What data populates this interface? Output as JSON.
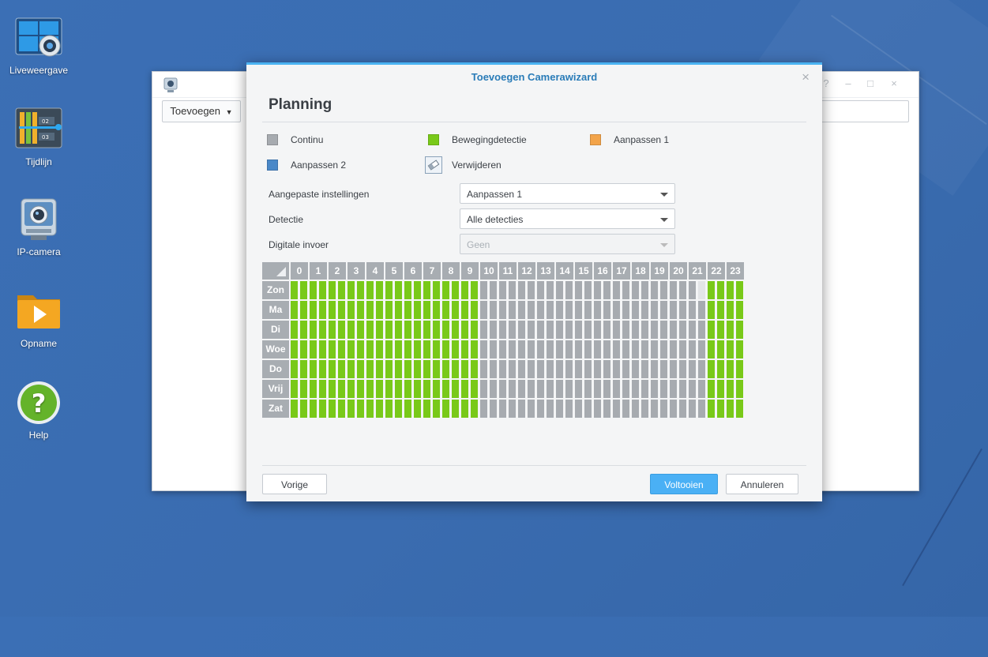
{
  "desktop": {
    "icons": [
      {
        "label": "Liveweergave",
        "icon": "liveview-icon"
      },
      {
        "label": "Tijdlijn",
        "icon": "timeline-icon"
      },
      {
        "label": "IP-camera",
        "icon": "ip-camera-icon"
      },
      {
        "label": "Opname",
        "icon": "recording-folder-icon"
      },
      {
        "label": "Help",
        "icon": "help-icon"
      }
    ]
  },
  "background_window": {
    "toolbar": {
      "add_label": "Toevoegen"
    },
    "controls": {
      "help": "?",
      "minimize": "–",
      "maximize": "□",
      "close": "×"
    }
  },
  "dialog": {
    "title": "Toevoegen Camerawizard",
    "close": "×",
    "heading": "Planning",
    "legend": {
      "continu": {
        "label": "Continu",
        "color": "#a7abb0"
      },
      "beweging": {
        "label": "Bewegingdetectie",
        "color": "#79c919"
      },
      "aanpassen1": {
        "label": "Aanpassen 1",
        "color": "#f3a44a"
      },
      "aanpassen2": {
        "label": "Aanpassen 2",
        "color": "#4a88c8"
      },
      "verwijderen": {
        "label": "Verwijderen",
        "icon": "eraser-icon"
      }
    },
    "form": {
      "custom_settings": {
        "label": "Aangepaste instellingen",
        "value": "Aanpassen 1"
      },
      "detection": {
        "label": "Detectie",
        "value": "Alle detecties"
      },
      "digital_input": {
        "label": "Digitale invoer",
        "value": "Geen",
        "disabled": true
      }
    },
    "schedule": {
      "hours": [
        "0",
        "1",
        "2",
        "3",
        "4",
        "5",
        "6",
        "7",
        "8",
        "9",
        "10",
        "11",
        "12",
        "13",
        "14",
        "15",
        "16",
        "17",
        "18",
        "19",
        "20",
        "21",
        "22",
        "23"
      ],
      "days": [
        "Zon",
        "Ma",
        "Di",
        "Woe",
        "Do",
        "Vrij",
        "Zat"
      ],
      "motion_hours": [
        0,
        1,
        2,
        3,
        4,
        5,
        6,
        7,
        8,
        9,
        22,
        23
      ],
      "empty_slots": [
        {
          "day": 0,
          "hour": 21,
          "half": 1
        }
      ]
    },
    "buttons": {
      "previous": "Vorige",
      "finish": "Voltooien",
      "cancel": "Annuleren"
    }
  }
}
